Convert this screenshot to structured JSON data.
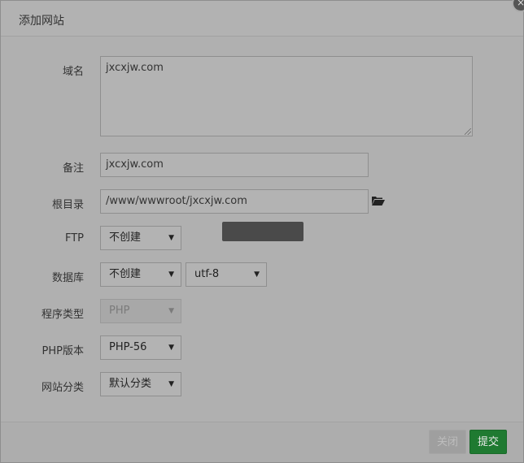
{
  "dialog": {
    "title": "添加网站",
    "close_glyph": "×"
  },
  "form": {
    "domain": {
      "label": "域名",
      "value": "jxcxjw.com"
    },
    "remark": {
      "label": "备注",
      "value": "jxcxjw.com"
    },
    "root_dir": {
      "label": "根目录",
      "value": "/www/wwwroot/jxcxjw.com",
      "icon": "folder-open-icon"
    },
    "ftp": {
      "label": "FTP",
      "selected": "不创建"
    },
    "database": {
      "label": "数据库",
      "selected": "不创建",
      "charset": "utf-8"
    },
    "program_type": {
      "label": "程序类型",
      "selected": "PHP",
      "disabled": true
    },
    "php_version": {
      "label": "PHP版本",
      "selected": "PHP-56"
    },
    "site_category": {
      "label": "网站分类",
      "selected": "默认分类"
    }
  },
  "footer": {
    "close_label": "关闭",
    "submit_label": "提交"
  },
  "colors": {
    "submit_bg": "#1f7a31",
    "overlay_bg": "#b0b0b0"
  }
}
